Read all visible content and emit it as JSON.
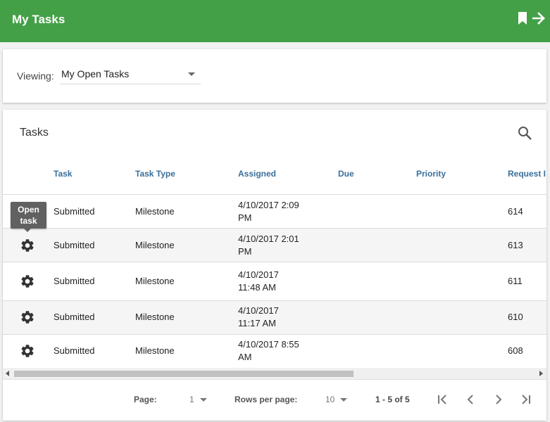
{
  "appbar": {
    "title": "My Tasks",
    "color": "#43a047",
    "icons": [
      "bookmark-icon",
      "arrow-right-icon"
    ]
  },
  "filter": {
    "label": "Viewing:",
    "selected": "My Open Tasks"
  },
  "tasks": {
    "title": "Tasks",
    "search_icon": "search-icon",
    "columns": [
      "Task",
      "Task Type",
      "Assigned",
      "Due",
      "Priority",
      "Request I"
    ],
    "tooltip": "Open task",
    "rows": [
      {
        "task": "Submitted",
        "type": "Milestone",
        "assigned_1": "4/10/2017 2:09",
        "assigned_2": "PM",
        "due": "",
        "priority": "",
        "request": "614"
      },
      {
        "task": "Submitted",
        "type": "Milestone",
        "assigned_1": "4/10/2017 2:01",
        "assigned_2": "PM",
        "due": "",
        "priority": "",
        "request": "613"
      },
      {
        "task": "Submitted",
        "type": "Milestone",
        "assigned_1": "4/10/2017",
        "assigned_2": "11:48 AM",
        "due": "",
        "priority": "",
        "request": "611"
      },
      {
        "task": "Submitted",
        "type": "Milestone",
        "assigned_1": "4/10/2017",
        "assigned_2": "11:17 AM",
        "due": "",
        "priority": "",
        "request": "610"
      },
      {
        "task": "Submitted",
        "type": "Milestone",
        "assigned_1": "4/10/2017 8:55",
        "assigned_2": "AM",
        "due": "",
        "priority": "",
        "request": "608"
      }
    ]
  },
  "pager": {
    "page_label": "Page:",
    "page_value": "1",
    "rows_label": "Rows per page:",
    "rows_value": "10",
    "range": "1 - 5 of 5"
  }
}
